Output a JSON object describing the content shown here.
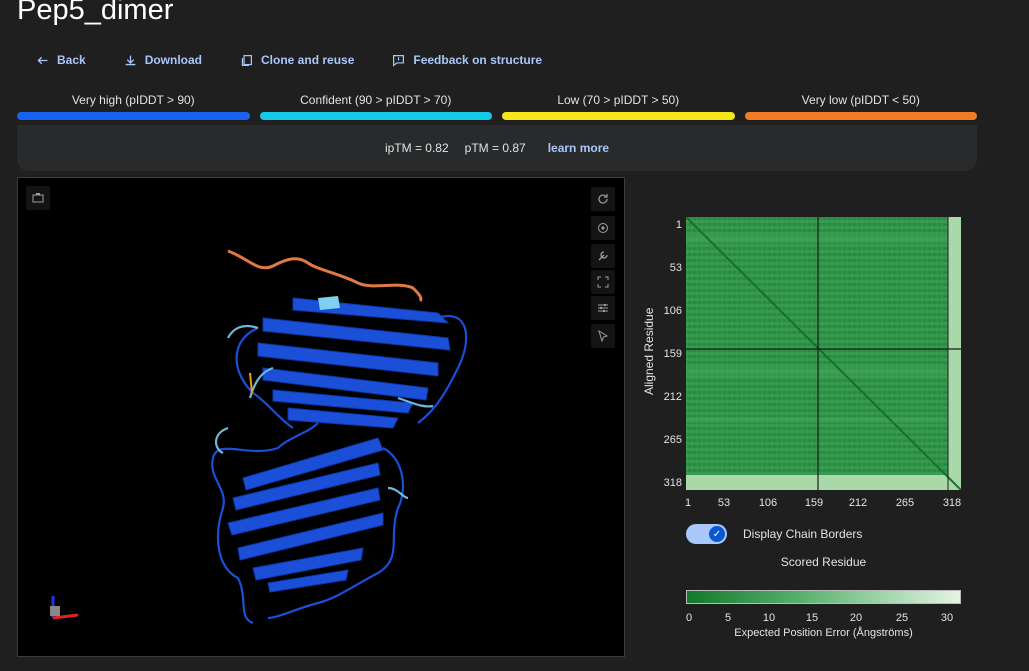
{
  "page": {
    "title": "Pep5_dimer"
  },
  "toolbar": {
    "back": "Back",
    "download": "Download",
    "clone": "Clone and reuse",
    "feedback": "Feedback on structure"
  },
  "plddt_legend": [
    {
      "label": "Very high (pIDDT > 90)",
      "color": "#1a63f0"
    },
    {
      "label": "Confident (90 > pIDDT > 70)",
      "color": "#14c8e8"
    },
    {
      "label": "Low (70 > pIDDT > 50)",
      "color": "#f5e61a"
    },
    {
      "label": "Very low (pIDDT < 50)",
      "color": "#f07d26"
    }
  ],
  "metrics": {
    "iptm": "ipTM = 0.82",
    "ptm": "pTM = 0.87",
    "learn_more": "learn more"
  },
  "viewer": {
    "controls": [
      "reset-view-icon",
      "spin-icon",
      "wrench-icon",
      "fullscreen-icon",
      "settings-icon",
      "cursor-icon"
    ]
  },
  "pae": {
    "ylabel": "Aligned Residue",
    "xlabel": "Scored Residue",
    "yticks": [
      "1",
      "53",
      "106",
      "159",
      "212",
      "265",
      "318"
    ],
    "xticks": [
      "1",
      "53",
      "106",
      "159",
      "212",
      "265",
      "318"
    ],
    "toggle_label": "Display Chain Borders",
    "toggle_on": true,
    "colorbar_ticks": [
      "0",
      "5",
      "10",
      "15",
      "20",
      "25",
      "30"
    ],
    "colorbar_label": "Expected Position Error (Ångströms)",
    "colors": {
      "low": "#12782d",
      "mid": "#5fb573",
      "high": "#e6f4e5"
    }
  }
}
